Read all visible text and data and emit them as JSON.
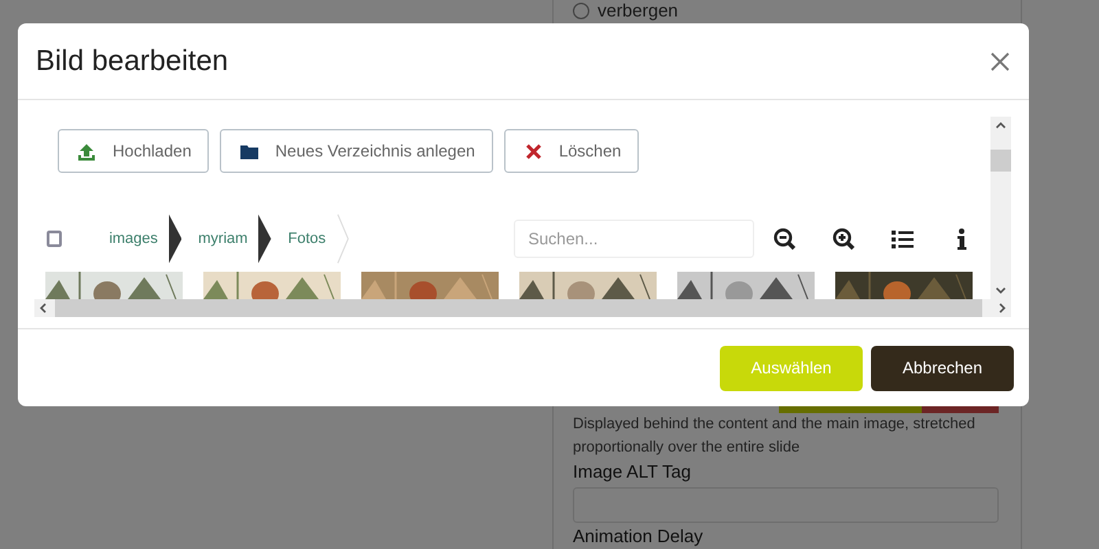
{
  "background_panel": {
    "radio": {
      "label": "verbergen",
      "checked": false
    },
    "help_text": "Displayed behind the content and the main image, stretched proportionally over the entire slide",
    "fields": [
      {
        "label": "Image ALT Tag"
      },
      {
        "label": "Animation Delay"
      }
    ]
  },
  "dialog": {
    "title": "Bild bearbeiten",
    "toolbar": [
      {
        "kind": "upload",
        "label": "Hochladen"
      },
      {
        "kind": "folder",
        "label": "Neues Verzeichnis anlegen"
      },
      {
        "kind": "delete",
        "label": "Löschen"
      }
    ],
    "select_all": {
      "checked": false
    },
    "breadcrumb": [
      "images",
      "myriam",
      "Fotos"
    ],
    "search": {
      "placeholder": "Suchen..."
    },
    "view_tools": [
      {
        "kind": "zoom-out"
      },
      {
        "kind": "zoom-in"
      },
      {
        "kind": "list"
      },
      {
        "kind": "info"
      }
    ],
    "thumbnails": [
      {
        "kind": "picture"
      },
      {
        "kind": "picture"
      },
      {
        "kind": "picture"
      },
      {
        "kind": "picture"
      },
      {
        "kind": "picture"
      },
      {
        "kind": "picture"
      }
    ],
    "footer_buttons": [
      {
        "kind": "primary",
        "label": "Auswählen"
      },
      {
        "kind": "secondary",
        "label": "Abbrechen"
      }
    ]
  }
}
